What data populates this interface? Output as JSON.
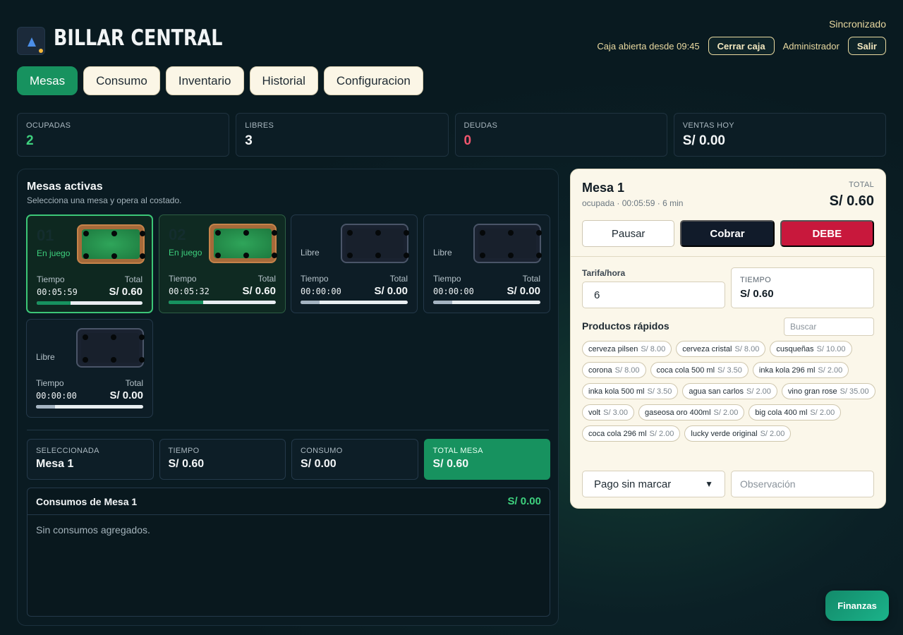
{
  "header": {
    "brand": "BILLAR CENTRAL",
    "sync_status": "Sincronizado",
    "cash_status": "Caja abierta desde 09:45",
    "close_cash_label": "Cerrar caja",
    "user_label": "Administrador",
    "logout_label": "Salir"
  },
  "tabs": [
    {
      "label": "Mesas",
      "active": true
    },
    {
      "label": "Consumo",
      "active": false
    },
    {
      "label": "Inventario",
      "active": false
    },
    {
      "label": "Historial",
      "active": false
    },
    {
      "label": "Configuracion",
      "active": false
    }
  ],
  "stats": [
    {
      "label": "OCUPADAS",
      "value": "2",
      "color": "#3ed17e"
    },
    {
      "label": "LIBRES",
      "value": "3",
      "color": "#f3f6f7"
    },
    {
      "label": "DEUDAS",
      "value": "0",
      "color": "#f0566e"
    },
    {
      "label": "VENTAS HOY",
      "value": "S/ 0.00",
      "color": "#f3f6f7"
    }
  ],
  "mesas_panel": {
    "title": "Mesas activas",
    "subtitle": "Selecciona una mesa y opera al costado.",
    "time_label": "Tiempo",
    "total_label": "Total",
    "mesas": [
      {
        "num": "01",
        "state": "En juego",
        "time": "00:05:59",
        "total": "S/ 0.60",
        "progress": 0.32,
        "busy": true,
        "selected": true
      },
      {
        "num": "02",
        "state": "En juego",
        "time": "00:05:32",
        "total": "S/ 0.60",
        "progress": 0.32,
        "busy": true,
        "selected": false
      },
      {
        "num": "",
        "state": "Libre",
        "time": "00:00:00",
        "total": "S/ 0.00",
        "progress": 0.18,
        "busy": false,
        "selected": false
      },
      {
        "num": "",
        "state": "Libre",
        "time": "00:00:00",
        "total": "S/ 0.00",
        "progress": 0.18,
        "busy": false,
        "selected": false
      },
      {
        "num": "",
        "state": "Libre",
        "time": "00:00:00",
        "total": "S/ 0.00",
        "progress": 0.18,
        "busy": false,
        "selected": false
      }
    ]
  },
  "summary": [
    {
      "label": "SELECCIONADA",
      "value": "Mesa 1"
    },
    {
      "label": "TIEMPO",
      "value": "S/ 0.60"
    },
    {
      "label": "CONSUMO",
      "value": "S/ 0.00"
    },
    {
      "label": "TOTAL MESA",
      "value": "S/ 0.60"
    }
  ],
  "consumos": {
    "title": "Consumos de Mesa 1",
    "total": "S/ 0.00",
    "empty_text": "Sin consumos agregados."
  },
  "detail": {
    "title": "Mesa 1",
    "subtitle": "ocupada · 00:05:59 · 6 min",
    "total_label": "TOTAL",
    "total": "S/ 0.60",
    "pause_label": "Pausar",
    "charge_label": "Cobrar",
    "debt_label": "DEBE",
    "rate_label": "Tarifa/hora",
    "rate_value": "6",
    "time_label": "TIEMPO",
    "time_value": "S/ 0.60",
    "quick_title": "Productos rápidos",
    "search_placeholder": "Buscar",
    "products": [
      {
        "name": "cerveza pilsen",
        "price": "S/ 8.00"
      },
      {
        "name": "cerveza cristal",
        "price": "S/ 8.00"
      },
      {
        "name": "cusqueñas",
        "price": "S/ 10.00"
      },
      {
        "name": "corona",
        "price": "S/ 8.00"
      },
      {
        "name": "coca cola 500 ml",
        "price": "S/ 3.50"
      },
      {
        "name": "inka kola 296 ml",
        "price": "S/ 2.00"
      },
      {
        "name": "inka kola 500 ml",
        "price": "S/ 3.50"
      },
      {
        "name": "agua san carlos",
        "price": "S/ 2.00"
      },
      {
        "name": "vino gran rose",
        "price": "S/ 35.00"
      },
      {
        "name": "volt",
        "price": "S/ 3.00"
      },
      {
        "name": "gaseosa oro 400ml",
        "price": "S/ 2.00"
      },
      {
        "name": "big cola 400 ml",
        "price": "S/ 2.00"
      },
      {
        "name": "coca cola 296 ml",
        "price": "S/ 2.00"
      },
      {
        "name": "lucky verde original",
        "price": "S/ 2.00"
      }
    ],
    "payment_value": "Pago sin marcar",
    "obs_placeholder": "Observación"
  },
  "fab_label": "Finanzas"
}
